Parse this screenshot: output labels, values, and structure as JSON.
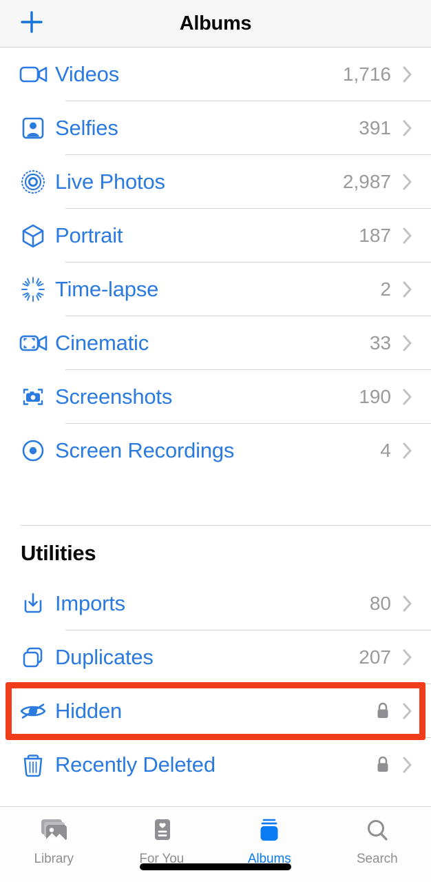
{
  "navbar": {
    "add_icon": "plus-icon",
    "title": "Albums"
  },
  "media_types": {
    "rows": [
      {
        "icon": "video-camera-icon",
        "label": "Videos",
        "count": "1,716"
      },
      {
        "icon": "person-portrait-icon",
        "label": "Selfies",
        "count": "391"
      },
      {
        "icon": "live-photo-icon",
        "label": "Live Photos",
        "count": "2,987"
      },
      {
        "icon": "cube-icon",
        "label": "Portrait",
        "count": "187"
      },
      {
        "icon": "timelapse-icon",
        "label": "Time-lapse",
        "count": "2"
      },
      {
        "icon": "cinematic-video-icon",
        "label": "Cinematic",
        "count": "33"
      },
      {
        "icon": "screenshot-camera-icon",
        "label": "Screenshots",
        "count": "190"
      },
      {
        "icon": "screen-recording-icon",
        "label": "Screen Recordings",
        "count": "4"
      }
    ]
  },
  "utilities": {
    "header": "Utilities",
    "rows": [
      {
        "icon": "import-download-icon",
        "label": "Imports",
        "count": "80",
        "locked": false
      },
      {
        "icon": "duplicate-squares-icon",
        "label": "Duplicates",
        "count": "207",
        "locked": false
      },
      {
        "icon": "hidden-eye-slash-icon",
        "label": "Hidden",
        "count": "",
        "locked": true
      },
      {
        "icon": "trash-icon",
        "label": "Recently Deleted",
        "count": "",
        "locked": true
      }
    ]
  },
  "highlight": {
    "target": "Hidden",
    "color": "#f03c18"
  },
  "tabbar": {
    "tabs": [
      {
        "icon": "photo-stack-icon",
        "label": "Library",
        "active": false
      },
      {
        "icon": "for-you-card-icon",
        "label": "For You",
        "active": false
      },
      {
        "icon": "albums-stack-icon",
        "label": "Albums",
        "active": true
      },
      {
        "icon": "magnifier-icon",
        "label": "Search",
        "active": false
      }
    ]
  },
  "colors": {
    "accent_blue": "#2b7ae0",
    "tab_active_blue": "#0b7bf1",
    "count_gray": "#9a9a9e",
    "highlight_red": "#f03c18"
  }
}
